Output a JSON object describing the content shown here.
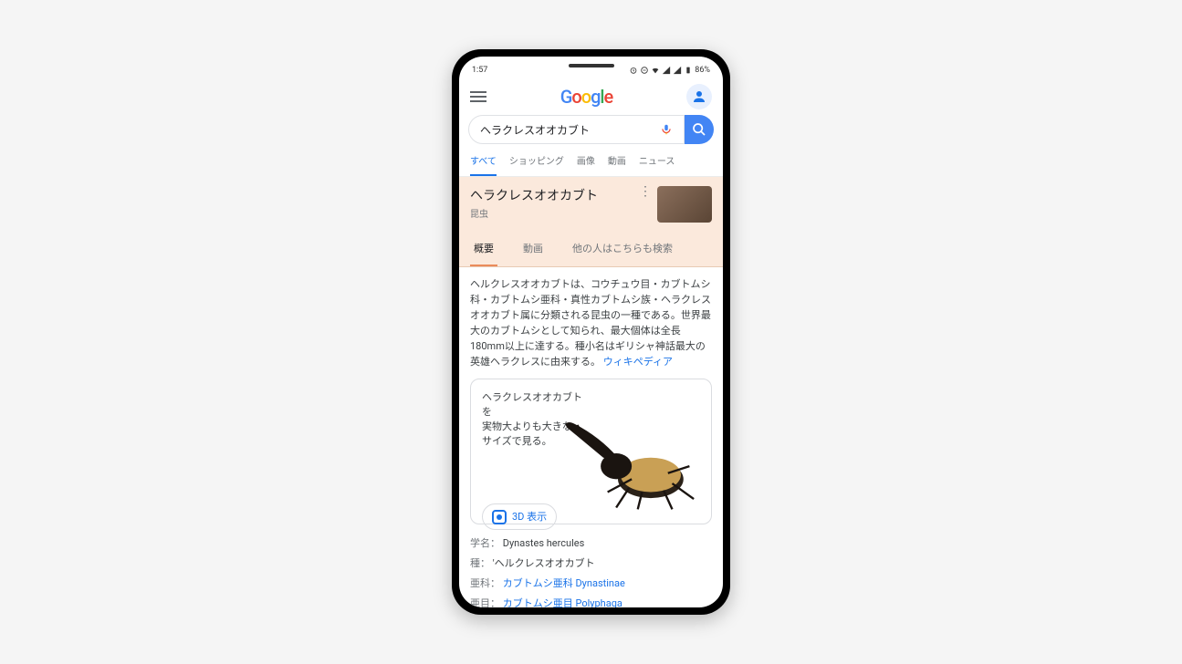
{
  "status": {
    "time": "1:57",
    "battery": "86%"
  },
  "logo": "Google",
  "search": {
    "query": "ヘラクレスオオカブト"
  },
  "nav_tabs": [
    "すべて",
    "ショッピング",
    "画像",
    "動画",
    "ニュース"
  ],
  "kg": {
    "title": "ヘラクレスオオカブト",
    "subtitle": "昆虫",
    "tabs": [
      "概要",
      "動画",
      "他の人はこちらも検索"
    ]
  },
  "description": "ヘルクレスオオカブトは、コウチュウ目・カブトムシ科・カブトムシ亜科・真性カブトムシ族・ヘラクレスオオカブト属に分類される昆虫の一種である。世界最大のカブトムシとして知られ、最大個体は全長180mm以上に達する。種小名はギリシャ神話最大の英雄ヘラクレスに由来する。",
  "desc_source": "ウィキペディア",
  "ar": {
    "line1": "ヘラクレスオオカブトを",
    "line2": "実物大よりも大きな",
    "line3": "サイズで見る。",
    "button": "3D 表示"
  },
  "facts": {
    "scientific_label": "学名：",
    "scientific_value": "Dynastes hercules",
    "species_label": "種：",
    "species_value": "'ヘルクレスオオカブト",
    "subfamily_label": "亜科：",
    "subfamily_value": "カブトムシ亜科 Dynastinae",
    "suborder_label": "亜目：",
    "suborder_value": "カブトムシ亜目 Polyphaga"
  }
}
